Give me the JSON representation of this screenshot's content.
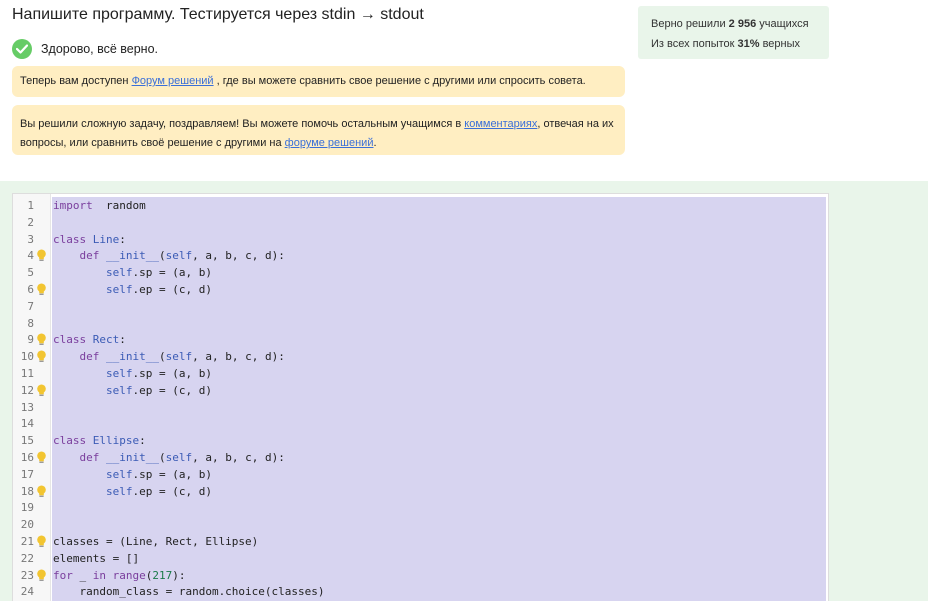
{
  "task": {
    "title": "Напишите программу. Тестируется через stdin → stdout",
    "success_text": "Здорово, всё верно."
  },
  "stats": {
    "solved_prefix": "Верно решили ",
    "solved_count": "2 956",
    "solved_suffix": " учащихся",
    "attempts_prefix": "Из всех попыток ",
    "attempts_percent": "31%",
    "attempts_suffix": " верных"
  },
  "notice1": {
    "before": "Теперь вам доступен ",
    "link": "Форум решений",
    "after": " , где вы можете сравнить свое решение с другими или спросить совета."
  },
  "notice2": {
    "before": "Вы решили сложную задачу, поздравляем! Вы можете помочь остальным учащимся в ",
    "link1": "комментариях",
    "middle": ", отвечая на их вопросы, или сравнить своё решение с другими на ",
    "link2": "форуме решений",
    "after": "."
  },
  "colors": {
    "success_green": "#66cc66",
    "notice_bg": "#ffeec2",
    "stats_bg": "#e9f5ea",
    "selection": "#d7d4f0",
    "link": "#3a6fd8"
  },
  "code": {
    "lines": [
      {
        "n": "1",
        "bulb": false,
        "tokens": [
          [
            "kw",
            "import"
          ],
          [
            "",
            "  random"
          ]
        ]
      },
      {
        "n": "2",
        "bulb": false,
        "tokens": []
      },
      {
        "n": "3",
        "bulb": false,
        "tokens": [
          [
            "kw",
            "class"
          ],
          [
            "",
            " "
          ],
          [
            "cls",
            "Line"
          ],
          [
            "",
            ":"
          ]
        ]
      },
      {
        "n": "4",
        "bulb": true,
        "tokens": [
          [
            "",
            "    "
          ],
          [
            "kw",
            "def"
          ],
          [
            "",
            " "
          ],
          [
            "dunder",
            "__init__"
          ],
          [
            "",
            "("
          ],
          [
            "self",
            "self"
          ],
          [
            "",
            ", a, b, c, d):"
          ]
        ]
      },
      {
        "n": "5",
        "bulb": false,
        "tokens": [
          [
            "",
            "        "
          ],
          [
            "self",
            "self"
          ],
          [
            "",
            ".sp = (a, b)"
          ]
        ]
      },
      {
        "n": "6",
        "bulb": true,
        "tokens": [
          [
            "",
            "        "
          ],
          [
            "self",
            "self"
          ],
          [
            "",
            ".ep = (c, d)"
          ]
        ]
      },
      {
        "n": "7",
        "bulb": false,
        "tokens": []
      },
      {
        "n": "8",
        "bulb": false,
        "tokens": []
      },
      {
        "n": "9",
        "bulb": true,
        "tokens": [
          [
            "kw",
            "class"
          ],
          [
            "",
            " "
          ],
          [
            "cls",
            "Rect"
          ],
          [
            "",
            ":"
          ]
        ]
      },
      {
        "n": "10",
        "bulb": true,
        "tokens": [
          [
            "",
            "    "
          ],
          [
            "kw",
            "def"
          ],
          [
            "",
            " "
          ],
          [
            "dunder",
            "__init__"
          ],
          [
            "",
            "("
          ],
          [
            "self",
            "self"
          ],
          [
            "",
            ", a, b, c, d):"
          ]
        ]
      },
      {
        "n": "11",
        "bulb": false,
        "tokens": [
          [
            "",
            "        "
          ],
          [
            "self",
            "self"
          ],
          [
            "",
            ".sp = (a, b)"
          ]
        ]
      },
      {
        "n": "12",
        "bulb": true,
        "tokens": [
          [
            "",
            "        "
          ],
          [
            "self",
            "self"
          ],
          [
            "",
            ".ep = (c, d)"
          ]
        ]
      },
      {
        "n": "13",
        "bulb": false,
        "tokens": []
      },
      {
        "n": "14",
        "bulb": false,
        "tokens": []
      },
      {
        "n": "15",
        "bulb": false,
        "tokens": [
          [
            "kw",
            "class"
          ],
          [
            "",
            " "
          ],
          [
            "cls",
            "Ellipse"
          ],
          [
            "",
            ":"
          ]
        ]
      },
      {
        "n": "16",
        "bulb": true,
        "tokens": [
          [
            "",
            "    "
          ],
          [
            "kw",
            "def"
          ],
          [
            "",
            " "
          ],
          [
            "dunder",
            "__init__"
          ],
          [
            "",
            "("
          ],
          [
            "self",
            "self"
          ],
          [
            "",
            ", a, b, c, d):"
          ]
        ]
      },
      {
        "n": "17",
        "bulb": false,
        "tokens": [
          [
            "",
            "        "
          ],
          [
            "self",
            "self"
          ],
          [
            "",
            ".sp = (a, b)"
          ]
        ]
      },
      {
        "n": "18",
        "bulb": true,
        "tokens": [
          [
            "",
            "        "
          ],
          [
            "self",
            "self"
          ],
          [
            "",
            ".ep = (c, d)"
          ]
        ]
      },
      {
        "n": "19",
        "bulb": false,
        "tokens": []
      },
      {
        "n": "20",
        "bulb": false,
        "tokens": []
      },
      {
        "n": "21",
        "bulb": true,
        "tokens": [
          [
            "",
            "classes = (Line, Rect, Ellipse)"
          ]
        ]
      },
      {
        "n": "22",
        "bulb": false,
        "tokens": [
          [
            "",
            "elements = []"
          ]
        ]
      },
      {
        "n": "23",
        "bulb": true,
        "tokens": [
          [
            "kw",
            "for"
          ],
          [
            "",
            " _ "
          ],
          [
            "kw",
            "in"
          ],
          [
            "",
            " "
          ],
          [
            "builtin",
            "range"
          ],
          [
            "",
            "("
          ],
          [
            "num",
            "217"
          ],
          [
            "",
            "):"
          ]
        ]
      },
      {
        "n": "24",
        "bulb": false,
        "tokens": [
          [
            "",
            "    random_class = random.choice(classes)"
          ]
        ]
      }
    ]
  }
}
